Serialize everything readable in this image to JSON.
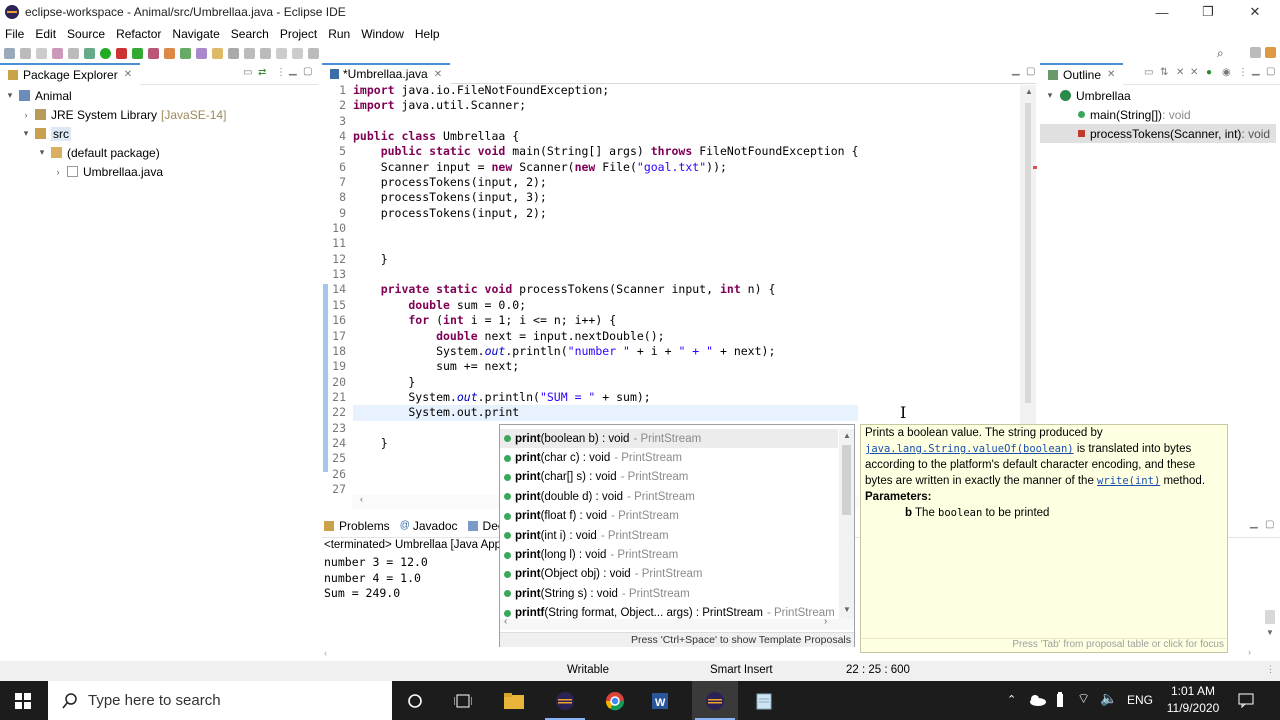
{
  "window": {
    "title": "eclipse-workspace - Animal/src/Umbrellaa.java - Eclipse IDE",
    "minimize": "—",
    "maximize": "❐",
    "close": "✕"
  },
  "menu": [
    "File",
    "Edit",
    "Source",
    "Refactor",
    "Navigate",
    "Search",
    "Project",
    "Run",
    "Window",
    "Help"
  ],
  "package_explorer": {
    "tab": "Package Explorer",
    "tree": [
      {
        "label": "Animal",
        "extra": ""
      },
      {
        "label": "JRE System Library",
        "extra": "[JavaSE-14]"
      },
      {
        "label": "src",
        "extra": ""
      },
      {
        "label": "(default package)",
        "extra": ""
      },
      {
        "label": "Umbrellaa.java",
        "extra": ""
      }
    ]
  },
  "editor": {
    "tab": "*Umbrellaa.java",
    "line_numbers": [
      "1",
      "2",
      "3",
      "4",
      "5",
      "6",
      "7",
      "8",
      "9",
      "10",
      "11",
      "12",
      "13",
      "14",
      "15",
      "16",
      "17",
      "18",
      "19",
      "20",
      "21",
      "22",
      "23",
      "24",
      "25",
      "26",
      "27"
    ],
    "code": {
      "l1": "import java.io.FileNotFoundException;",
      "l2": "import java.util.Scanner;",
      "l4a": "public class ",
      "l4b": "Umbrellaa {",
      "l5a": "    public static void ",
      "l5b": "main(String[] args) ",
      "l5c": "throws",
      "l5d": " FileNotFoundException {",
      "l6a": "    Scanner input = ",
      "l6b": "new",
      "l6c": " Scanner(",
      "l6d": "new",
      "l6e": " File(",
      "l6f": "\"goal.txt\"",
      "l6g": "));",
      "l7": "    processTokens(input, 2);",
      "l8": "    processTokens(input, 3);",
      "l9": "    processTokens(input, 2);",
      "l12": "    }",
      "l14a": "    private static void ",
      "l14b": "processTokens(Scanner input, ",
      "l14c": "int",
      "l14d": " n) {",
      "l15a": "        double",
      "l15b": " sum = 0.0;",
      "l16a": "        for",
      "l16b": " (",
      "l16c": "int",
      "l16d": " i = 1; i <= n; i++) {",
      "l17a": "            double",
      "l17b": " next = input.nextDouble();",
      "l18a": "            System.",
      "l18b": "out",
      "l18c": ".println(",
      "l18d": "\"number \"",
      "l18e": " + i + ",
      "l18f": "\" + \"",
      "l18g": " + next);",
      "l19": "            sum += next;",
      "l20": "        }",
      "l21a": "        System.",
      "l21b": "out",
      "l21c": ".println(",
      "l21d": "\"SUM = \"",
      "l21e": " + sum);",
      "l22": "        System.out.print",
      "l24": "    }"
    }
  },
  "outline": {
    "tab": "Outline",
    "class": "Umbrellaa",
    "members": [
      {
        "label": "main(String[])",
        "type": " : void"
      },
      {
        "label": "processTokens(Scanner, int)",
        "type": " : void"
      }
    ]
  },
  "bottom_panel": {
    "tabs": [
      "Problems",
      "Javadoc",
      "Declaration"
    ],
    "terminated": "<terminated> Umbrellaa [Java Application]",
    "lines": [
      "number 3 = 12.0",
      "number 4 = 1.0",
      "Sum = 249.0"
    ]
  },
  "autocomplete": {
    "items": [
      {
        "name": "print",
        "args": "(boolean b)",
        "ret": " : void",
        "cls": "- PrintStream"
      },
      {
        "name": "print",
        "args": "(char c)",
        "ret": " : void",
        "cls": "- PrintStream"
      },
      {
        "name": "print",
        "args": "(char[] s)",
        "ret": " : void",
        "cls": "- PrintStream"
      },
      {
        "name": "print",
        "args": "(double d)",
        "ret": " : void",
        "cls": "- PrintStream"
      },
      {
        "name": "print",
        "args": "(float f)",
        "ret": " : void",
        "cls": "- PrintStream"
      },
      {
        "name": "print",
        "args": "(int i)",
        "ret": " : void",
        "cls": "- PrintStream"
      },
      {
        "name": "print",
        "args": "(long l)",
        "ret": " : void",
        "cls": "- PrintStream"
      },
      {
        "name": "print",
        "args": "(Object obj)",
        "ret": " : void",
        "cls": "- PrintStream"
      },
      {
        "name": "print",
        "args": "(String s)",
        "ret": " : void",
        "cls": "- PrintStream"
      },
      {
        "name": "printf",
        "args": "(String format, Object... args)",
        "ret": " : PrintStream",
        "cls": "- PrintStream"
      }
    ],
    "footer": "Press 'Ctrl+Space' to show Template Proposals"
  },
  "tooltip": {
    "t1": "Prints a boolean value. The string produced by",
    "link1": "java.lang.String.valueOf(boolean)",
    "t2": " is translated into bytes",
    "t3": "according to the platform's default character encoding, and these",
    "t4": "bytes are written in exactly the manner of the ",
    "link2": "write(int)",
    "t5": " method.",
    "params": "Parameters:",
    "p_name": "b",
    "p_pre": " The ",
    "p_code": "boolean",
    "p_post": " to be printed",
    "footer": "Press 'Tab' from proposal table or click for focus"
  },
  "status": {
    "writable": "Writable",
    "insert": "Smart Insert",
    "position": "22 : 25 : 600"
  },
  "taskbar": {
    "search_placeholder": "Type here to search",
    "time": "1:01 AM",
    "date": "11/9/2020",
    "lang": "ENG"
  },
  "colors": {
    "keyword": "#7f0055",
    "string": "#2a00ff",
    "field": "#0000c0",
    "taskbar": "#1c1c1c"
  }
}
